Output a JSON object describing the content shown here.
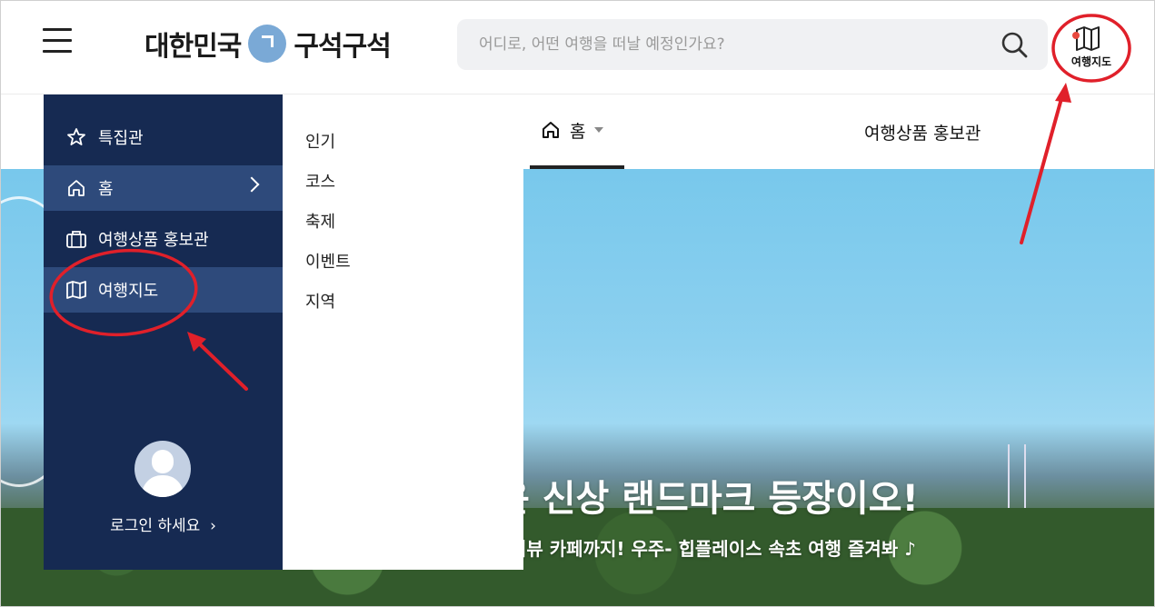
{
  "header": {
    "logo_left": "대한민국",
    "logo_right": "구석구석",
    "search_placeholder": "어디로, 어떤 여행을 떠날 예정인가요?",
    "map_button_label": "여행지도"
  },
  "topnav": {
    "home_label": "홈",
    "promo_label": "여행상품 홍보관"
  },
  "drawer": {
    "items": [
      {
        "label": "특집관",
        "icon": "star-icon"
      },
      {
        "label": "홈",
        "icon": "home-icon"
      },
      {
        "label": "여행상품 홍보관",
        "icon": "briefcase-icon"
      },
      {
        "label": "여행지도",
        "icon": "map-icon"
      }
    ],
    "login_label": "로그인 하세요"
  },
  "submenu": {
    "items": [
      "인기",
      "코스",
      "축제",
      "이벤트",
      "지역"
    ]
  },
  "hero": {
    "title": "운 신상 랜드마크 등장이오!",
    "subtitle": "위뷰 카페까지! 우주- 힙플레이스 속초 여행 즐겨봐 ♪"
  },
  "colors": {
    "drawer_bg": "#162a52",
    "drawer_active": "#2e4a7b",
    "annotation_red": "#e0202a",
    "logo_accent": "#7aa9d6"
  }
}
